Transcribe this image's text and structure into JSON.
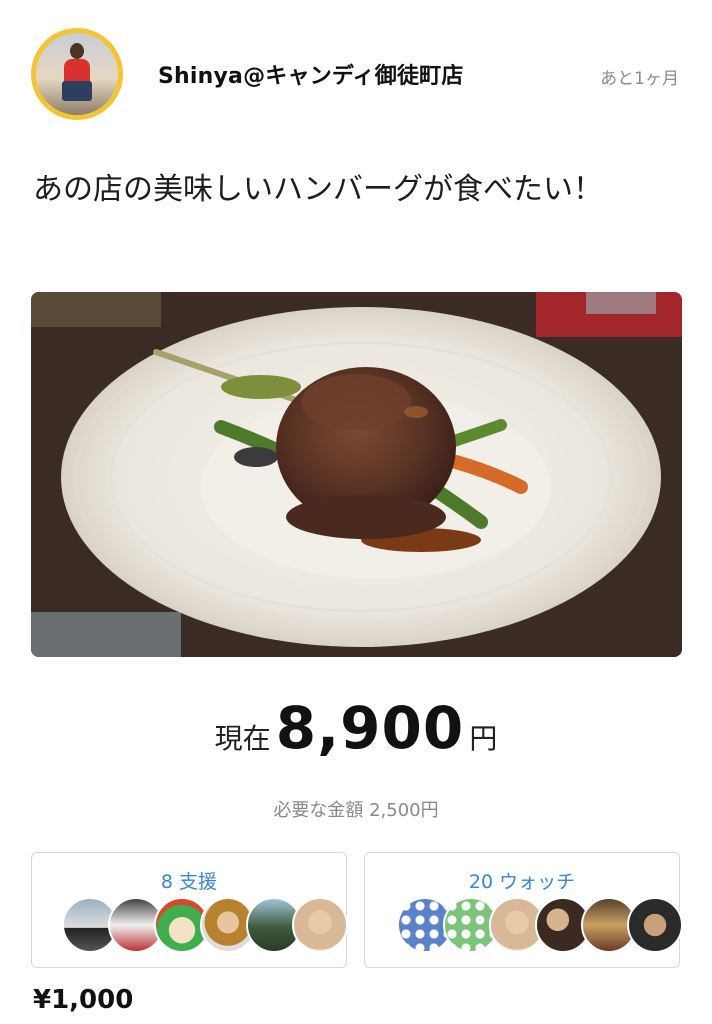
{
  "header": {
    "user_name": "Shinya@キャンディ御徒町店",
    "remaining": "あと1ヶ月"
  },
  "project": {
    "title": "あの店の美味しいハンバーグが食べたい！"
  },
  "funding": {
    "current_label": "現在",
    "current_amount": "8,900",
    "currency_unit": "円",
    "needed_text": "必要な金額 2,500円"
  },
  "supporters": {
    "label": "8 支援",
    "avatars": [
      "supporter-1",
      "supporter-2",
      "supporter-3",
      "supporter-4",
      "supporter-5",
      "supporter-6"
    ]
  },
  "watchers": {
    "label": "20 ウォッチ",
    "avatars": [
      "watcher-1",
      "watcher-2",
      "watcher-3",
      "watcher-4",
      "watcher-5",
      "watcher-6"
    ]
  },
  "reward": {
    "price": "¥1,000"
  },
  "colors": {
    "accent": "#3a85d4",
    "avatar_ring": "#f3c535"
  }
}
